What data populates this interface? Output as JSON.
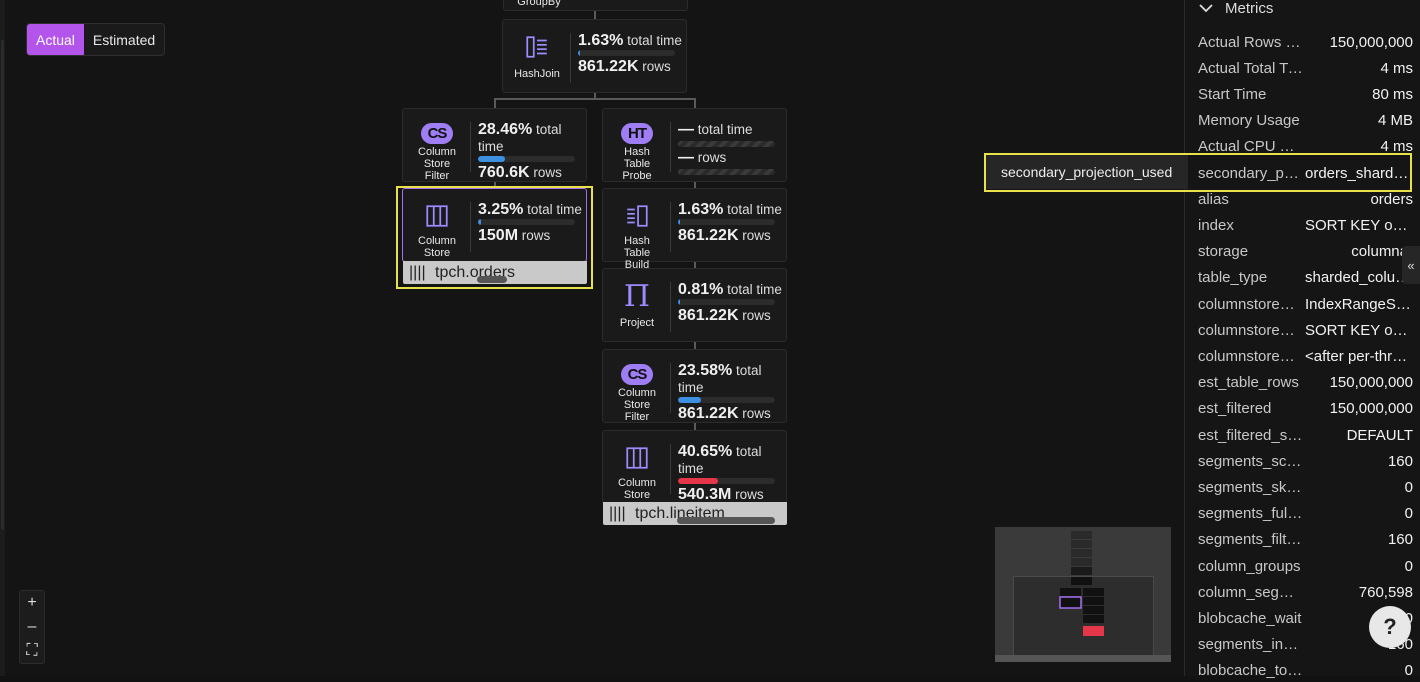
{
  "toggle": {
    "actual": "Actual",
    "estimated": "Estimated"
  },
  "nodes": {
    "groupby": {
      "label": "GroupBy"
    },
    "hashjoin": {
      "label": "HashJoin",
      "pct": "1.63%",
      "time_suffix": "total time",
      "count": "861.22K",
      "count_suffix": "rows",
      "time_fraction": 0.02
    },
    "csfilter1": {
      "badge": "CS",
      "label": "Column Store Filter",
      "pct": "28.46%",
      "time_suffix": "total time",
      "count": "760.6K",
      "count_suffix": "rows",
      "time_fraction": 0.28
    },
    "htprobe": {
      "badge": "HT",
      "label": "Hash Table Probe",
      "pct": "—",
      "time_suffix": "total time",
      "count": "—",
      "count_suffix": "rows"
    },
    "csscan1": {
      "label": "Column Store Scan",
      "pct": "3.25%",
      "time_suffix": "total time",
      "count": "150M",
      "count_suffix": "rows",
      "time_fraction": 0.03,
      "table": "tpch.orders"
    },
    "htbuild": {
      "label": "Hash Table Build",
      "pct": "1.63%",
      "time_suffix": "total time",
      "count": "861.22K",
      "count_suffix": "rows",
      "time_fraction": 0.02
    },
    "project": {
      "label": "Project",
      "pct": "0.81%",
      "time_suffix": "total time",
      "count": "861.22K",
      "count_suffix": "rows",
      "time_fraction": 0.01
    },
    "csfilter2": {
      "badge": "CS",
      "label": "Column Store Filter",
      "pct": "23.58%",
      "time_suffix": "total time",
      "count": "861.22K",
      "count_suffix": "rows",
      "time_fraction": 0.24
    },
    "csscan2": {
      "label": "Column Store Scan",
      "pct": "40.65%",
      "time_suffix": "total time",
      "count": "540.3M",
      "count_suffix": "rows",
      "time_fraction": 0.41,
      "table": "tpch.lineitem"
    }
  },
  "colors": {
    "accent": "#b355ea",
    "badge": "#9f7ef5",
    "bar_blue": "#3d8fe0",
    "bar_red": "#e5364a",
    "highlight": "#e9e14a"
  },
  "zoom": {
    "in": "+",
    "out": "–",
    "fit": "⛶"
  },
  "tooltip": {
    "text": "secondary_projection_used"
  },
  "panel": {
    "title": "Metrics",
    "rows": [
      {
        "k": "Actual Rows Processed",
        "v": "150,000,000"
      },
      {
        "k": "Actual Total Time",
        "v": "4 ms"
      },
      {
        "k": "Start Time",
        "v": "80 ms"
      },
      {
        "k": "Memory Usage",
        "v": "4 MB"
      },
      {
        "k": "Actual CPU Time",
        "v": "4 ms"
      },
      {
        "k": "secondary_projection_used",
        "v": "orders_shard_key"
      },
      {
        "k": "alias",
        "v": "orders"
      },
      {
        "k": "index",
        "v": "SORT KEY o_orderkey"
      },
      {
        "k": "storage",
        "v": "columnar"
      },
      {
        "k": "table_type",
        "v": "sharded_columnstore"
      },
      {
        "k": "columnstore_index",
        "v": "IndexRangeScan"
      },
      {
        "k": "columnstore_sort",
        "v": "SORT KEY o_orderkey"
      },
      {
        "k": "columnstore_filter",
        "v": "<after per-thread scan>"
      },
      {
        "k": "est_table_rows",
        "v": "150,000,000"
      },
      {
        "k": "est_filtered",
        "v": "150,000,000"
      },
      {
        "k": "est_filtered_source",
        "v": "DEFAULT"
      },
      {
        "k": "segments_scanned",
        "v": "160"
      },
      {
        "k": "segments_skipped",
        "v": "0"
      },
      {
        "k": "segments_fully_contained",
        "v": "0"
      },
      {
        "k": "segments_filtered",
        "v": "160"
      },
      {
        "k": "column_groups",
        "v": "0"
      },
      {
        "k": "column_segments",
        "v": "760,598"
      },
      {
        "k": "blobcache_wait",
        "v": "0"
      },
      {
        "k": "segments_in_blobcache",
        "v": "160"
      },
      {
        "k": "blobcache_total",
        "v": "0"
      }
    ]
  },
  "help": {
    "label": "?"
  }
}
